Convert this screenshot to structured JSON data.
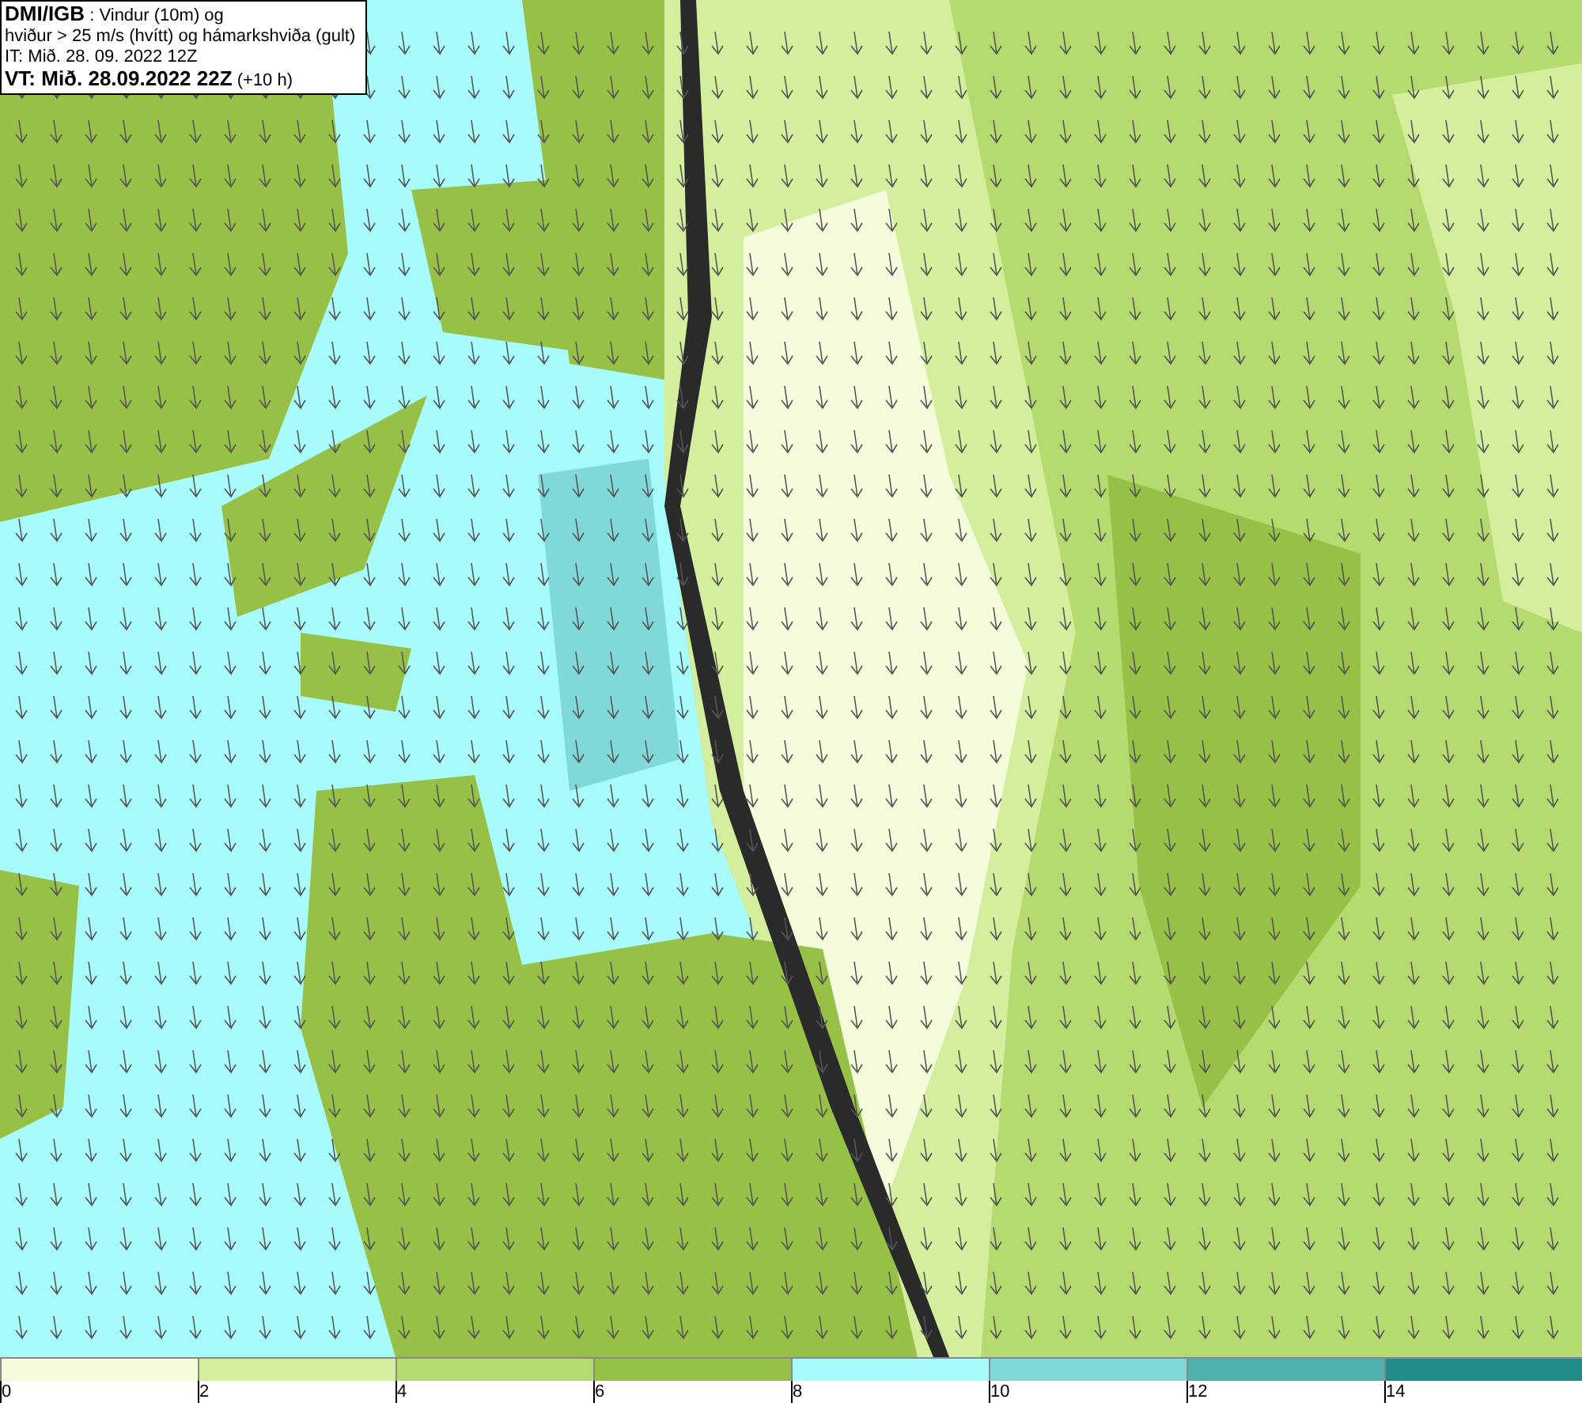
{
  "info_box": {
    "lines": [
      "**DMI/IGB** : Vindur (10m) og",
      "hviður > 25 m/s (hvítt) og hámarkshviða (gult)",
      "IT: Mið. 28. 09. 2022 12Z",
      "**VT: Mið. 28.09.2022 22Z** (+10 h)"
    ]
  },
  "legend": {
    "bins": [
      {
        "color": "#f5fcdc"
      },
      {
        "color": "#d3ee9c"
      },
      {
        "color": "#b5da70"
      },
      {
        "color": "#96c046"
      },
      {
        "color": "#a8fbfb"
      },
      {
        "color": "#80d8d8"
      },
      {
        "color": "#50b0b0"
      },
      {
        "color": "#208c8c"
      }
    ],
    "ticks": [
      "0",
      "2",
      "4",
      "6",
      "8",
      "10",
      "12",
      "14"
    ]
  }
}
